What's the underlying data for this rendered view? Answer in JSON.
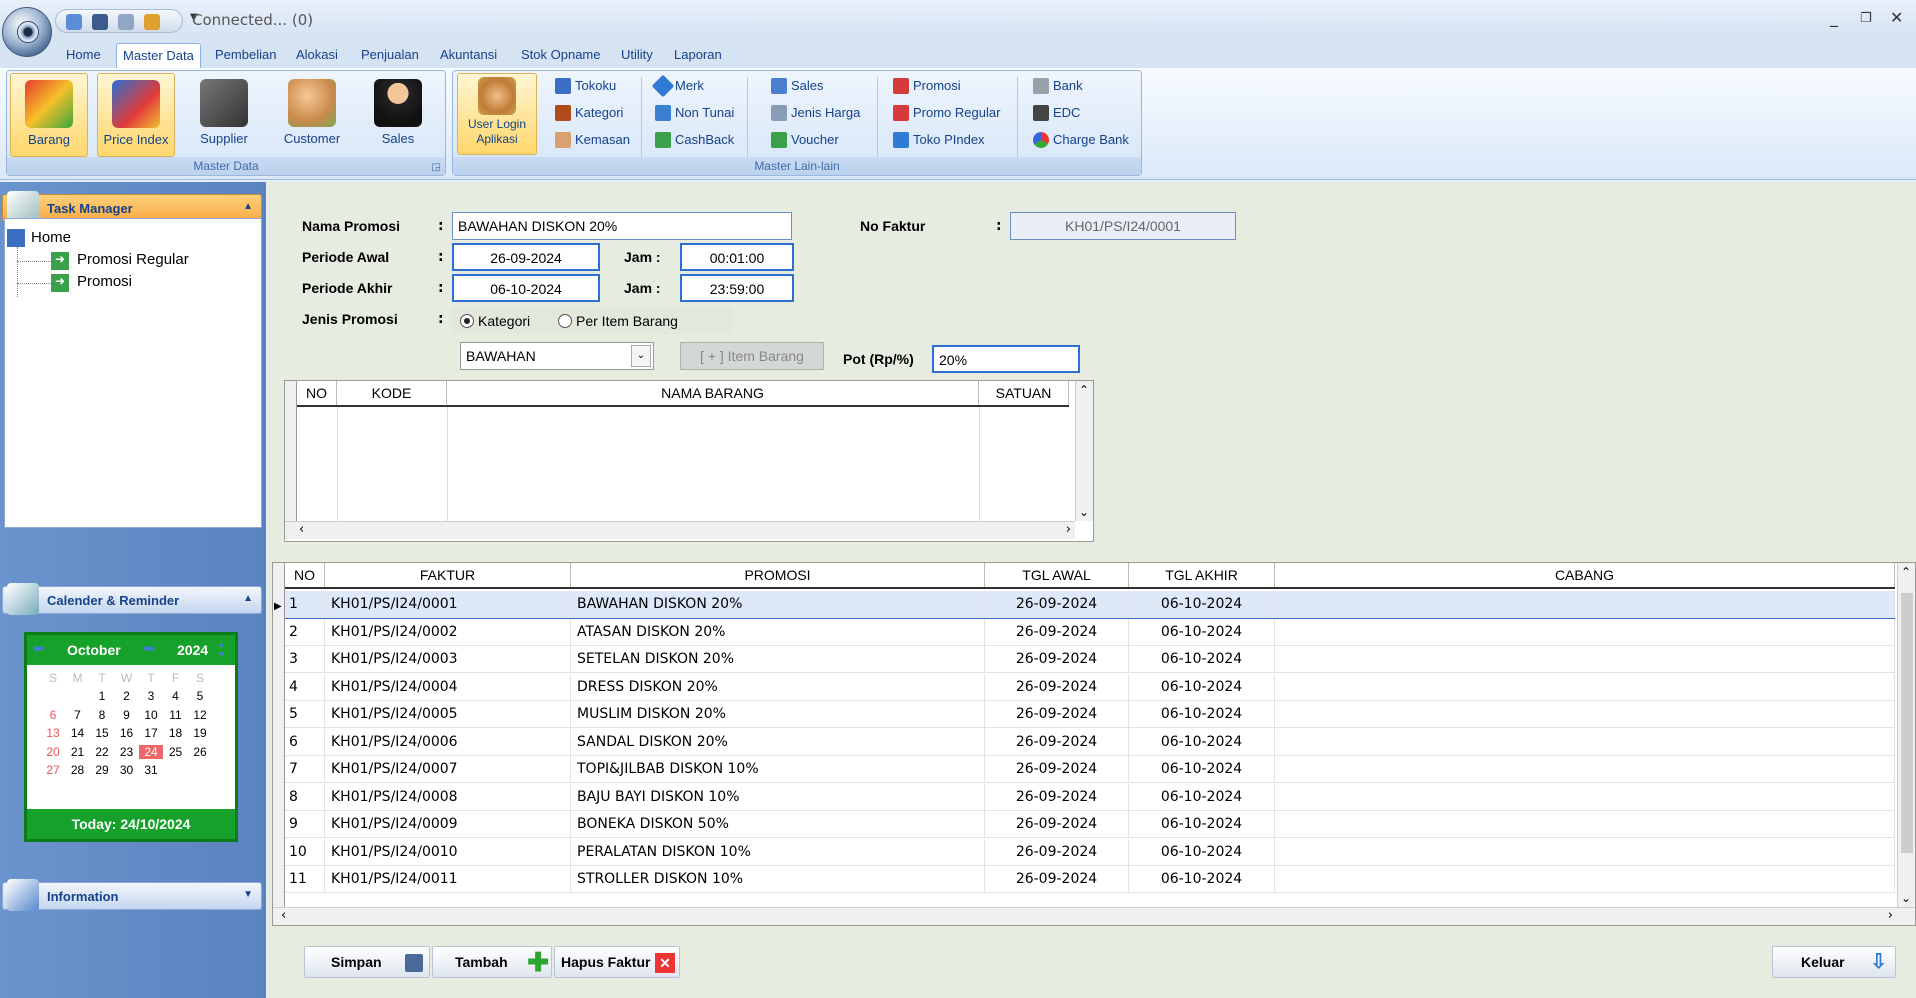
{
  "titlebar": {
    "status": "Connected... (0)",
    "min": "_",
    "max": "❐",
    "close": "✕"
  },
  "tabs": [
    "Home",
    "Master Data",
    "Pembelian",
    "Alokasi",
    "Penjualan",
    "Akuntansi",
    "Stok Opname",
    "Utility",
    "Laporan"
  ],
  "ribbon": {
    "master_data": {
      "label": "Master Data",
      "buttons": [
        "Barang",
        "Price Index",
        "Supplier",
        "Customer",
        "Sales"
      ]
    },
    "user_login": "User Login Aplikasi",
    "master_lain": {
      "label": "Master Lain-lain",
      "col1": [
        "Tokoku",
        "Kategori",
        "Kemasan"
      ],
      "col2": [
        "Merk",
        "Non Tunai",
        "CashBack"
      ],
      "col3": [
        "Sales",
        "Jenis Harga",
        "Voucher"
      ],
      "col4": [
        "Promosi",
        "Promo Regular",
        "Toko PIndex"
      ],
      "col5": [
        "Bank",
        "EDC",
        "Charge Bank"
      ]
    }
  },
  "task_manager": {
    "title": "Task Manager",
    "home": "Home",
    "items": [
      "Promosi Regular",
      "Promosi"
    ]
  },
  "calendar": {
    "title": "Calender & Reminder",
    "month": "October",
    "year": "2024",
    "days": [
      "S",
      "M",
      "T",
      "W",
      "T",
      "F",
      "S"
    ],
    "today": "Today: 24/10/2024",
    "selected": 24
  },
  "information": {
    "title": "Information"
  },
  "form": {
    "nama_promosi_label": "Nama Promosi",
    "nama_promosi": "BAWAHAN DISKON 20%",
    "no_faktur_label": "No Faktur",
    "no_faktur": "KH01/PS/I24/0001",
    "periode_awal_label": "Periode Awal",
    "periode_awal": "26-09-2024",
    "periode_akhir_label": "Periode Akhir",
    "periode_akhir": "06-10-2024",
    "jam_label": "Jam :",
    "jam_awal": "00:01:00",
    "jam_akhir": "23:59:00",
    "jenis_label": "Jenis Promosi",
    "radio_kategori": "Kategori",
    "radio_item": "Per Item Barang",
    "kategori_value": "BAWAHAN",
    "item_barang_btn": "[ + ] Item Barang",
    "pot_label": "Pot (Rp/%)",
    "pot_value": "20%",
    "colon": ":"
  },
  "item_grid": {
    "headers": [
      "NO",
      "KODE",
      "NAMA BARANG",
      "SATUAN"
    ]
  },
  "list_grid": {
    "headers": [
      "NO",
      "FAKTUR",
      "PROMOSI",
      "TGL AWAL",
      "TGL AKHIR",
      "CABANG"
    ],
    "rows": [
      [
        "1",
        "KH01/PS/I24/0001",
        "BAWAHAN DISKON 20%",
        "26-09-2024",
        "06-10-2024",
        ""
      ],
      [
        "2",
        "KH01/PS/I24/0002",
        "ATASAN DISKON 20%",
        "26-09-2024",
        "06-10-2024",
        ""
      ],
      [
        "3",
        "KH01/PS/I24/0003",
        "SETELAN DISKON 20%",
        "26-09-2024",
        "06-10-2024",
        ""
      ],
      [
        "4",
        "KH01/PS/I24/0004",
        "DRESS DISKON 20%",
        "26-09-2024",
        "06-10-2024",
        ""
      ],
      [
        "5",
        "KH01/PS/I24/0005",
        "MUSLIM DISKON 20%",
        "26-09-2024",
        "06-10-2024",
        ""
      ],
      [
        "6",
        "KH01/PS/I24/0006",
        "SANDAL DISKON 20%",
        "26-09-2024",
        "06-10-2024",
        ""
      ],
      [
        "7",
        "KH01/PS/I24/0007",
        "TOPI&JILBAB DISKON 10%",
        "26-09-2024",
        "06-10-2024",
        ""
      ],
      [
        "8",
        "KH01/PS/I24/0008",
        "BAJU BAYI DISKON 10%",
        "26-09-2024",
        "06-10-2024",
        ""
      ],
      [
        "9",
        "KH01/PS/I24/0009",
        "BONEKA DISKON 50%",
        "26-09-2024",
        "06-10-2024",
        ""
      ],
      [
        "10",
        "KH01/PS/I24/0010",
        "PERALATAN DISKON 10%",
        "26-09-2024",
        "06-10-2024",
        ""
      ],
      [
        "11",
        "KH01/PS/I24/0011",
        "STROLLER DISKON 10%",
        "26-09-2024",
        "06-10-2024",
        ""
      ]
    ]
  },
  "buttons": {
    "simpan": "Simpan",
    "tambah": "Tambah",
    "hapus": "Hapus Faktur",
    "keluar": "Keluar"
  }
}
